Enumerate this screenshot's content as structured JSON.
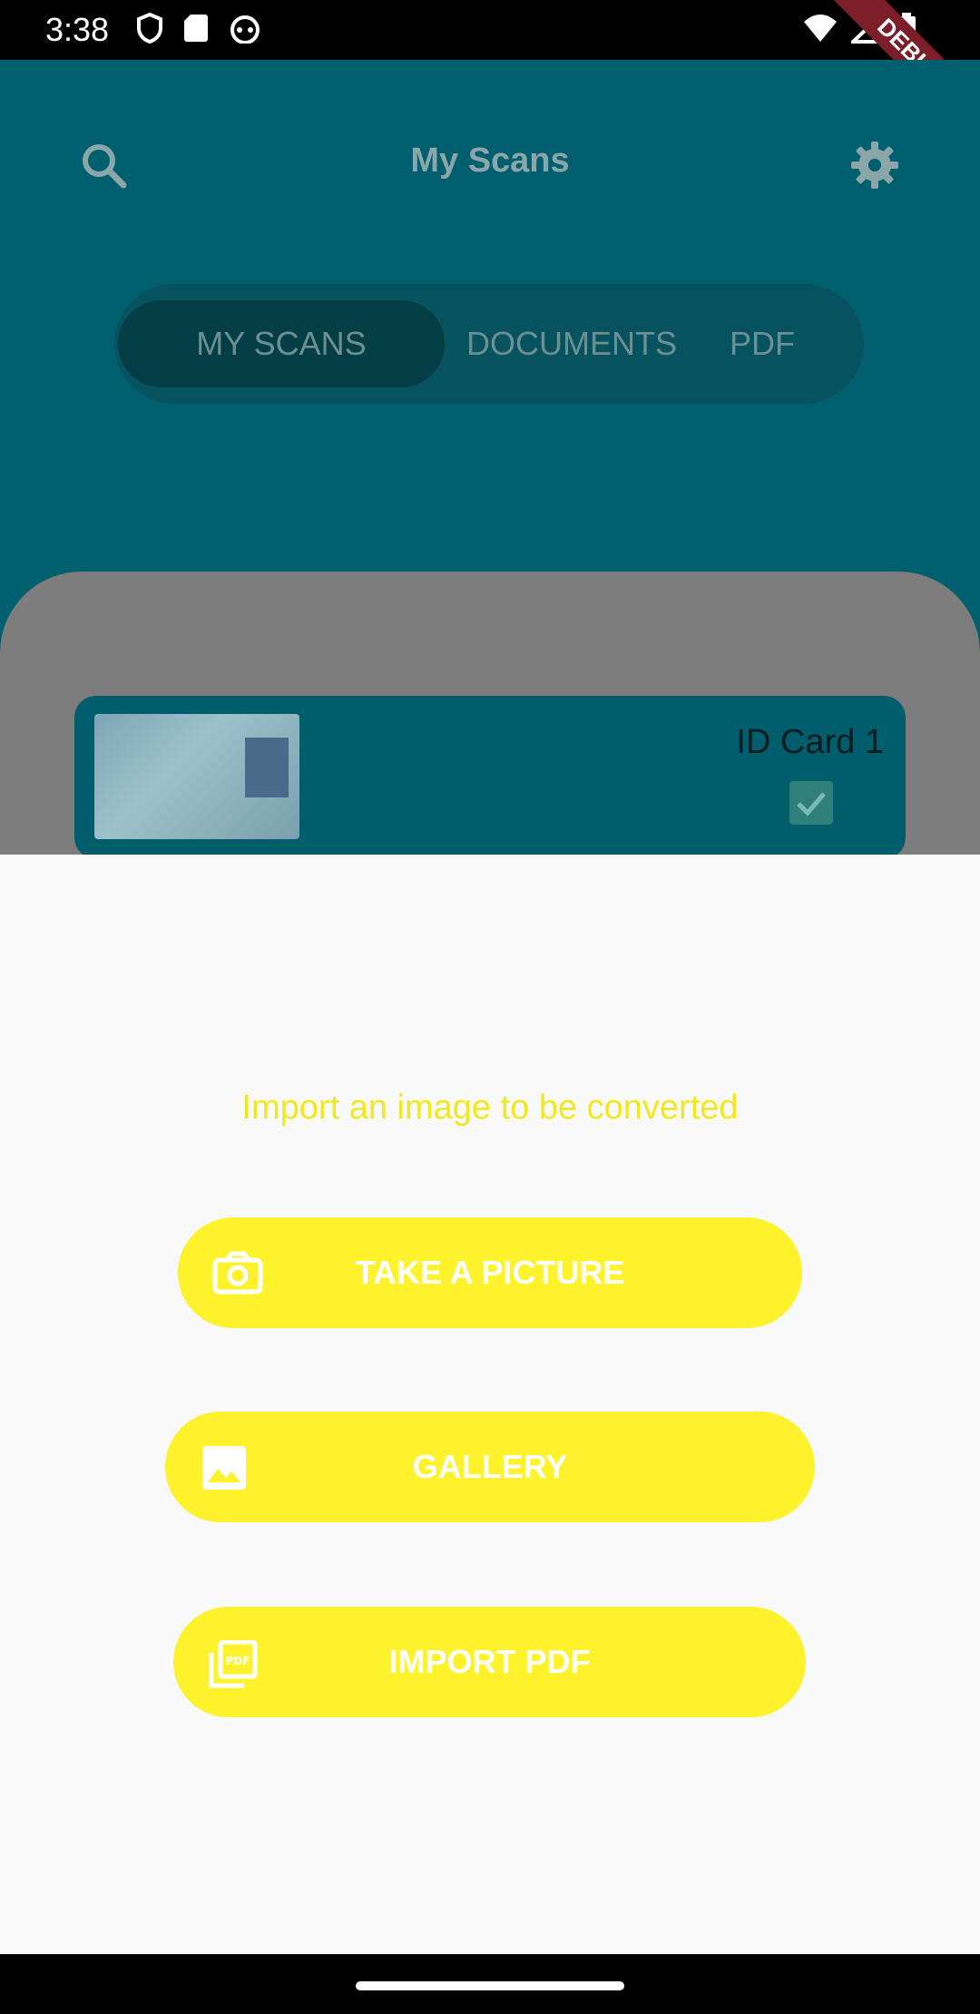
{
  "status_bar": {
    "time": "3:38",
    "left_icons": [
      "shield-icon",
      "sd-card-icon",
      "cat-icon"
    ],
    "right_icons": [
      "wifi-icon",
      "signal-icon",
      "battery-icon"
    ],
    "debug_label": "DEBUG"
  },
  "header": {
    "title": "My Scans",
    "search_icon": "search-icon",
    "settings_icon": "gear-icon"
  },
  "tabs": [
    {
      "label": "MY SCANS",
      "active": true
    },
    {
      "label": "DOCUMENTS",
      "active": false
    },
    {
      "label": "PDF",
      "active": false
    }
  ],
  "scan_item": {
    "title": "ID Card 1",
    "checked": true
  },
  "sheet": {
    "prompt": "Import an image to be converted",
    "buttons": [
      {
        "label": "TAKE A PICTURE",
        "icon": "camera-icon"
      },
      {
        "label": "GALLERY",
        "icon": "image-icon"
      },
      {
        "label": "IMPORT PDF",
        "icon": "pdf-icon"
      }
    ],
    "accent_color": "#fdf22c"
  }
}
